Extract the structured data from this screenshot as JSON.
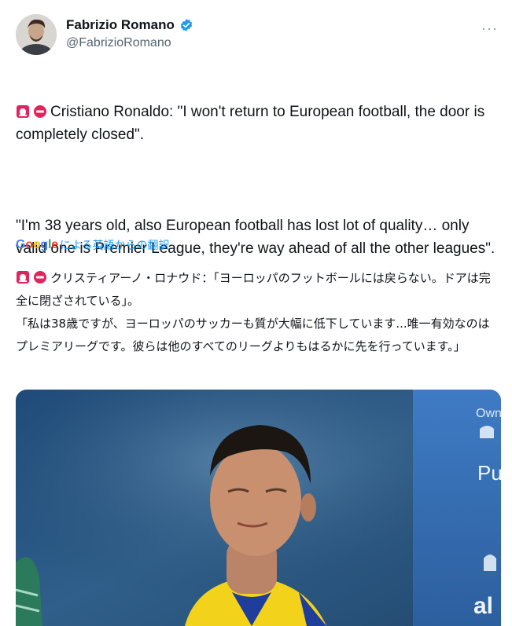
{
  "author": {
    "display_name": "Fabrizio Romano",
    "handle": "@FabrizioRomano",
    "verified": true
  },
  "menu": {
    "icon": "more-icon",
    "glyph": "···"
  },
  "tweet": {
    "emoji": [
      "siren-icon",
      "no-entry-icon"
    ],
    "line1": "Cristiano Ronaldo: \"I won't return to European football, the door is completely closed\".",
    "quote": "\"I'm 38 years old, also European football has lost lot of quality… only valid one is Premier League, they're way ahead of all the other leagues\"."
  },
  "translation": {
    "provider": "Google",
    "label": "による英語からの翻訳",
    "line1": "クリスティアーノ・ロナウド：「ヨーロッパのフットボールには戻らない。ドアは完全に閉ざされている」。",
    "quote": "「私は38歳ですが、ヨーロッパのサッカーも質が大幅に低下しています...唯一有効なのはプレミアリーグです。彼らは他のすべてのリーグよりもはるかに先を行っています。」"
  },
  "media": {
    "sign_text": [
      "Own",
      "Pu",
      "al"
    ]
  },
  "colors": {
    "verified": "#1d9bf0",
    "link": "#1d9bf0",
    "secondary_text": "#536471",
    "jersey_yellow": "#f2d21b",
    "jersey_blue": "#1f3e9c"
  }
}
